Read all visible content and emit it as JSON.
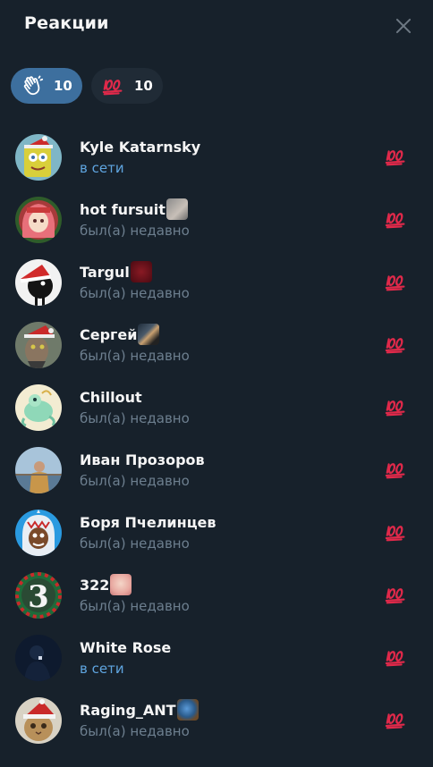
{
  "header": {
    "title": "Реакции"
  },
  "filters": [
    {
      "emoji": "clap-icon",
      "count": "10"
    },
    {
      "emoji": "hundred-icon",
      "count": "10"
    }
  ],
  "users": [
    {
      "name": "Kyle Katarnsky",
      "status": "в сети",
      "online": true
    },
    {
      "name": "hot fursuit",
      "status": "был(а) недавно",
      "online": false
    },
    {
      "name": "Targul",
      "status": "был(а) недавно",
      "online": false
    },
    {
      "name": "Сергей",
      "status": "был(а) недавно",
      "online": false
    },
    {
      "name": "Chillout",
      "status": "был(а) недавно",
      "online": false
    },
    {
      "name": "Иван Прозоров",
      "status": "был(а) недавно",
      "online": false
    },
    {
      "name": "Боря Пчелинцев",
      "status": "был(а) недавно",
      "online": false
    },
    {
      "name": "322",
      "status": "был(а) недавно",
      "online": false
    },
    {
      "name": "White Rose",
      "status": "в сети",
      "online": true
    },
    {
      "name": "Raging_ANT",
      "status": "был(а) недавно",
      "online": false
    }
  ],
  "colors": {
    "background": "#17212b",
    "accent": "#3d6f9e",
    "online": "#5fa5e0",
    "muted": "#6d7f8f",
    "reaction": "#e0294a"
  }
}
